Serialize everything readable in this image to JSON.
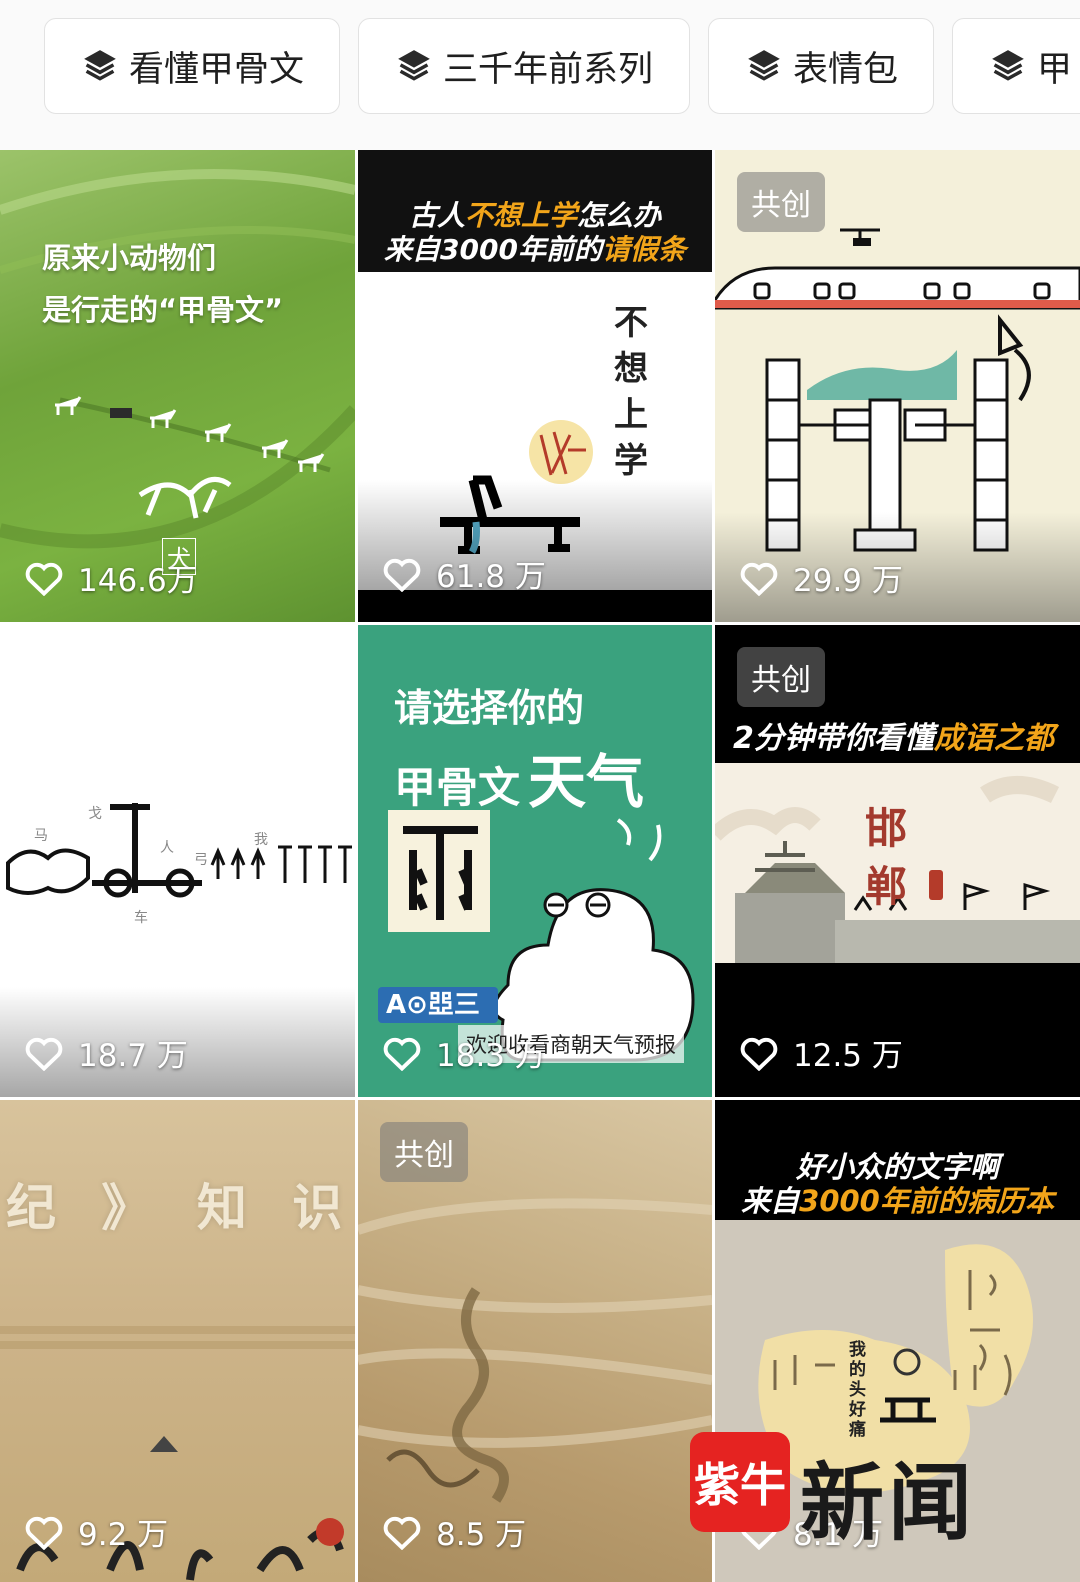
{
  "chips": [
    {
      "label": "看懂甲骨文",
      "icon": "layers-icon"
    },
    {
      "label": "三千年前系列",
      "icon": "layers-icon"
    },
    {
      "label": "表情包",
      "icon": "layers-icon"
    },
    {
      "label": "甲",
      "icon": "layers-icon"
    }
  ],
  "tiles": [
    {
      "likes": "146.6万",
      "caption_lines": [
        "原来小动物们",
        "是行走的“甲骨文”"
      ],
      "char_label": "犬"
    },
    {
      "likes": "61.8 万",
      "caption_line1": [
        "古人",
        "不想上学",
        "怎么办"
      ],
      "caption_line2": [
        "来自3000年前的",
        "请假条"
      ],
      "vertical_text": "不想上学"
    },
    {
      "likes": "29.9 万",
      "badge": "共创"
    },
    {
      "likes": "18.7 万",
      "small_labels": [
        "马",
        "戈",
        "人",
        "弓",
        "我",
        "车"
      ]
    },
    {
      "likes": "18.3 万",
      "caption_line1": "请选择你的",
      "caption_line2a": "甲骨文",
      "caption_line2b": "天气",
      "subtitle": "欢迎收看商朝天气预报",
      "sign_text": "A⊙𠁁三"
    },
    {
      "likes": "12.5 万",
      "badge": "共创",
      "caption": [
        "2分钟带你看懂",
        "成语之都"
      ],
      "city_chars": [
        "邯",
        "郸"
      ]
    },
    {
      "likes": "9.2 万",
      "overlay_text": "纪 》 知 识 库"
    },
    {
      "likes": "8.5 万",
      "badge": "共创"
    },
    {
      "likes": "8.1 万",
      "caption_line1": "好小众的文字啊",
      "caption_line2": [
        "来自",
        "3000年前的病历本"
      ],
      "note": "我的头好痛"
    }
  ],
  "watermark": {
    "logo": "紫牛",
    "text": "新闻"
  },
  "colors": {
    "accent": "#f2a51a",
    "green_tile": "#3aa27e",
    "logo_red": "#e52321"
  }
}
